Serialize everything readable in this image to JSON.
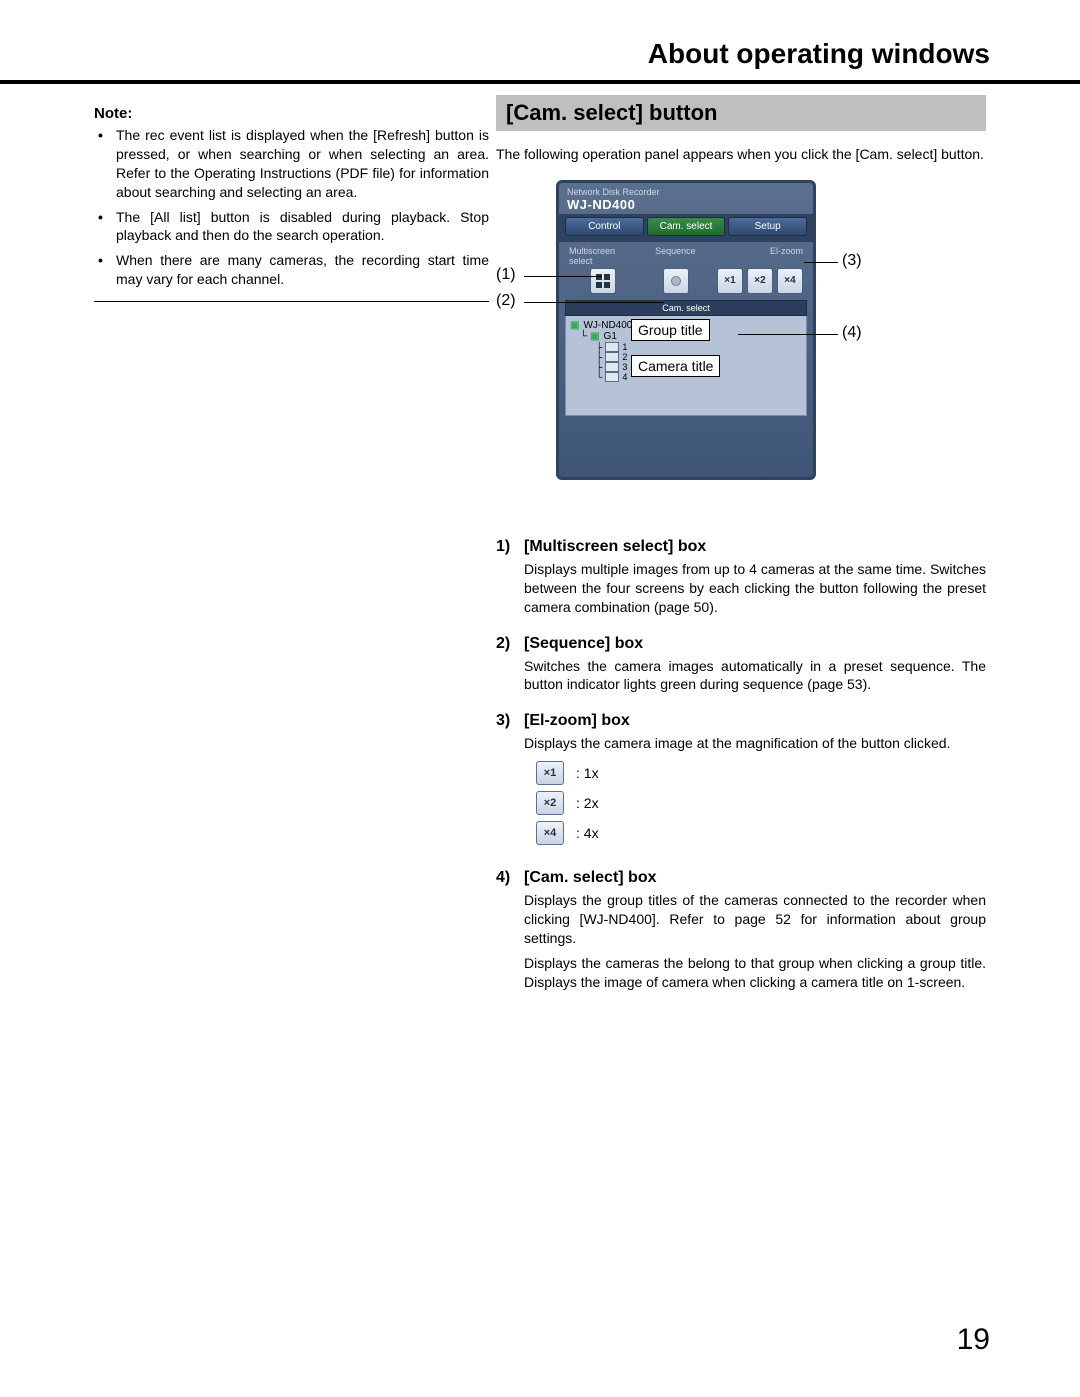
{
  "page": {
    "title": "About operating windows",
    "number": "19"
  },
  "left": {
    "note_label": "Note:",
    "notes": [
      "The rec event list is displayed when the [Refresh] button is pressed, or when searching or when selecting an area. Refer to the Operating Instructions (PDF file) for information about searching and selecting an area.",
      "The [All list] button is disabled during playback. Stop playback and then do the search operation.",
      "When there are many cameras, the recording start time may vary for each channel."
    ]
  },
  "right": {
    "heading": "[Cam. select] button",
    "intro": "The following operation panel appears when you click the [Cam. select] button.",
    "panel": {
      "subtitle": "Network Disk Recorder",
      "model": "WJ-ND400",
      "tabs": {
        "control": "Control",
        "cam": "Cam. select",
        "setup": "Setup"
      },
      "row": {
        "ms": "Multiscreen select",
        "seq": "Sequence",
        "ez": "El-zoom"
      },
      "zoom": {
        "x1": "×1",
        "x2": "×2",
        "x4": "×4"
      },
      "tree_title": "Cam. select",
      "tree": {
        "root": "WJ-ND400",
        "group": "G1",
        "cams": [
          "1",
          "2",
          "3",
          "4"
        ]
      }
    },
    "callouts": {
      "c1": "(1)",
      "c2": "(2)",
      "c3": "(3)",
      "c4": "(4)"
    },
    "anno": {
      "group": "Group title",
      "camera": "Camera title"
    },
    "defs": [
      {
        "num": "1)",
        "title": "[Multiscreen select] box",
        "body": "Displays multiple images from up to 4 cameras at the same time. Switches between the four screens by each clicking the button following the preset camera combination (page 50)."
      },
      {
        "num": "2)",
        "title": "[Sequence] box",
        "body": "Switches the camera images automatically in a preset sequence. The button indicator lights green during sequence (page 53)."
      },
      {
        "num": "3)",
        "title": "[El-zoom] box",
        "body": "Displays the camera image at the magnification of the button clicked."
      },
      {
        "num": "4)",
        "title": "[Cam. select] box",
        "body": "Displays the group titles of the cameras connected to the recorder when clicking [WJ-ND400]. Refer to page 52 for information about group settings.",
        "body2": "Displays the cameras the belong to that group when clicking a group title. Displays the image of camera when clicking a camera title on 1-screen."
      }
    ],
    "zoom_legend": [
      {
        "btn": "×1",
        "label": ":  1x"
      },
      {
        "btn": "×2",
        "label": ":  2x"
      },
      {
        "btn": "×4",
        "label": ":  4x"
      }
    ]
  }
}
